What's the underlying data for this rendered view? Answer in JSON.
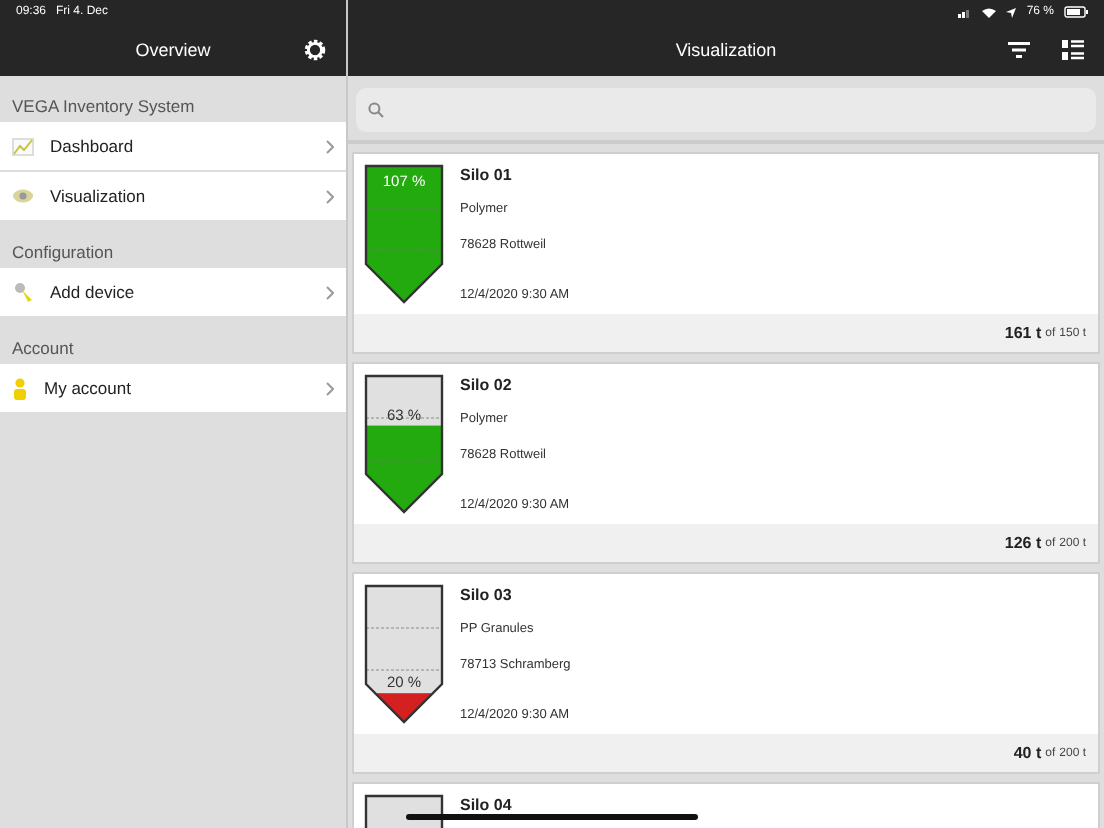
{
  "status_bar": {
    "time": "09:36",
    "date": "Fri 4. Dec",
    "battery": "76 %"
  },
  "sidebar": {
    "title": "Overview",
    "sections": [
      {
        "heading": "VEGA Inventory System",
        "items": [
          {
            "label": "Dashboard",
            "kind": "chart"
          },
          {
            "label": "Visualization",
            "kind": "eye"
          }
        ]
      },
      {
        "heading": "Configuration",
        "items": [
          {
            "label": "Add device",
            "kind": "device"
          }
        ]
      },
      {
        "heading": "Account",
        "items": [
          {
            "label": "My account",
            "kind": "person"
          }
        ]
      }
    ]
  },
  "main": {
    "title": "Visualization",
    "silos": [
      {
        "name": "Silo 01",
        "product": "Polymer",
        "location": "78628 Rottweil",
        "timestamp": "12/4/2020 9:30 AM",
        "percent": "107 %",
        "level": 1,
        "color": "#22aa0f",
        "amount": "161 t",
        "of": "of",
        "capacity": "150 t"
      },
      {
        "name": "Silo 02",
        "product": "Polymer",
        "location": "78628 Rottweil",
        "timestamp": "12/4/2020 9:30 AM",
        "percent": "63 %",
        "level": 0.63,
        "color": "#22aa0f",
        "amount": "126 t",
        "of": "of",
        "capacity": "200 t"
      },
      {
        "name": "Silo 03",
        "product": "PP Granules",
        "location": "78713 Schramberg",
        "timestamp": "12/4/2020 9:30 AM",
        "percent": "20 %",
        "level": 0.2,
        "color": "#d42020",
        "amount": "40 t",
        "of": "of",
        "capacity": "200 t"
      },
      {
        "name": "Silo 04"
      }
    ]
  }
}
